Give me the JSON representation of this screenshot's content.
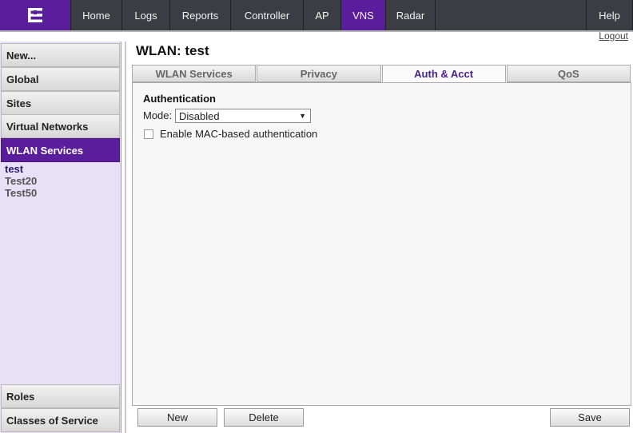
{
  "nav": {
    "items": [
      {
        "label": "Home",
        "width": 64
      },
      {
        "label": "Logs",
        "width": 60
      },
      {
        "label": "Reports",
        "width": 76
      },
      {
        "label": "Controller",
        "width": 91
      },
      {
        "label": "AP",
        "width": 47
      },
      {
        "label": "VNS",
        "width": 56
      },
      {
        "label": "Radar",
        "width": 62
      }
    ],
    "help": "Help",
    "logout": "Logout",
    "brand_color": "#5a1e9c"
  },
  "sidebar": {
    "new": "New...",
    "global": "Global",
    "sites": "Sites",
    "virtual_networks": "Virtual Networks",
    "wlan_services": "WLAN Services",
    "links": [
      "test",
      "Test20",
      "Test50"
    ],
    "roles": "Roles",
    "classes_of_service": "Classes of Service"
  },
  "main": {
    "title": "WLAN: test",
    "tabs": [
      "WLAN Services",
      "Privacy",
      "Auth & Acct",
      "QoS"
    ],
    "active_tab": "Auth & Acct",
    "section_title": "Authentication",
    "mode_label": "Mode:",
    "mode_value": "Disabled",
    "mac_auth_label": "Enable MAC-based authentication",
    "mac_auth_checked": false
  },
  "buttons": {
    "new": "New",
    "delete": "Delete",
    "save": "Save"
  }
}
